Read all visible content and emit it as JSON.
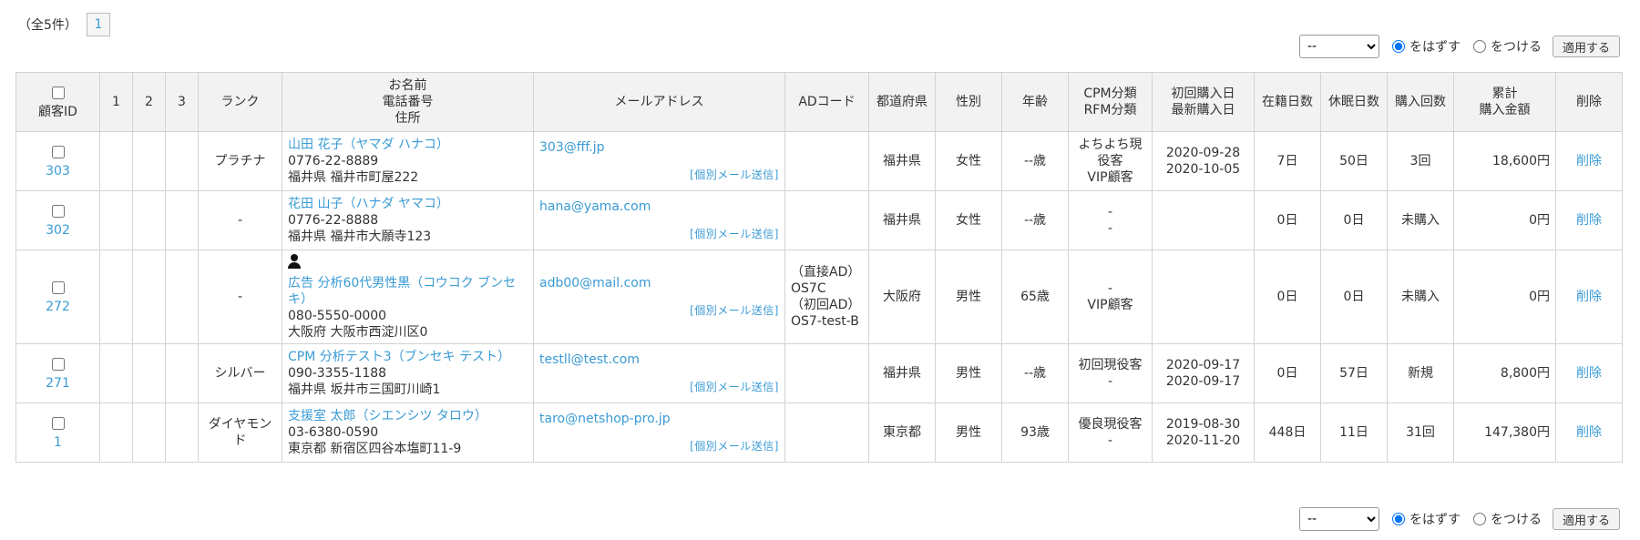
{
  "pager": {
    "total": "（全5件）",
    "page": "1"
  },
  "bulk": {
    "select_value": "--",
    "radio_remove": "をはずす",
    "radio_add": "をつける",
    "apply": "適用する"
  },
  "headers": {
    "id": "顧客ID",
    "c1": "1",
    "c2": "2",
    "c3": "3",
    "rank": "ランク",
    "name1": "お名前",
    "name2": "電話番号",
    "name3": "住所",
    "email": "メールアドレス",
    "ad": "ADコード",
    "pref": "都道府県",
    "gender": "性別",
    "age": "年齢",
    "cpm1": "CPM分類",
    "cpm2": "RFM分類",
    "buy1": "初回購入日",
    "buy2": "最新購入日",
    "days": "在籍日数",
    "dormant": "休眠日数",
    "count": "購入回数",
    "total1": "累計",
    "total2": "購入金額",
    "delete": "削除"
  },
  "mail_send_label": "[個別メール送信]",
  "delete_label": "削除",
  "rows": [
    {
      "id": "303",
      "rank": "プラチナ",
      "name": "山田 花子（ヤマダ ハナコ）",
      "phone": "0776-22-8889",
      "address": "福井県 福井市町屋222",
      "email": "303@fff.jp",
      "ad_line1": "",
      "ad_line2": "",
      "ad_line3": "",
      "ad_line4": "",
      "pref": "福井県",
      "gender": "女性",
      "age": "--歳",
      "cpm_line1": "よちよち現",
      "cpm_line2": "役客",
      "cpm_line3": "VIP顧客",
      "first_buy": "2020-09-28",
      "last_buy": "2020-10-05",
      "days": "7日",
      "dormant": "50日",
      "count": "3回",
      "total": "18,600円"
    },
    {
      "id": "302",
      "rank": "-",
      "name": "花田 山子（ハナダ ヤマコ）",
      "phone": "0776-22-8888",
      "address": "福井県 福井市大願寺123",
      "email": "hana@yama.com",
      "ad_line1": "",
      "ad_line2": "",
      "ad_line3": "",
      "ad_line4": "",
      "pref": "福井県",
      "gender": "女性",
      "age": "--歳",
      "cpm_line1": "-",
      "cpm_line2": "-",
      "cpm_line3": "",
      "first_buy": "",
      "last_buy": "",
      "days": "0日",
      "dormant": "0日",
      "count": "未購入",
      "total": "0円"
    },
    {
      "id": "272",
      "rank": "-",
      "name": "広告 分析60代男性黒（コウコク ブンセキ）",
      "phone": "080-5550-0000",
      "address": "大阪府 大阪市西淀川区0",
      "email": "adb00@mail.com",
      "ad_line1": "（直接AD）",
      "ad_line2": "OS7C",
      "ad_line3": "（初回AD）",
      "ad_line4": "OS7-test-B",
      "pref": "大阪府",
      "gender": "男性",
      "age": "65歳",
      "cpm_line1": "-",
      "cpm_line2": "VIP顧客",
      "cpm_line3": "",
      "first_buy": "",
      "last_buy": "",
      "days": "0日",
      "dormant": "0日",
      "count": "未購入",
      "total": "0円"
    },
    {
      "id": "271",
      "rank": "シルバー",
      "name": "CPM 分析テスト3（ブンセキ テスト）",
      "phone": "090-3355-1188",
      "address": "福井県 坂井市三国町川崎1",
      "email": "testll@test.com",
      "ad_line1": "",
      "ad_line2": "",
      "ad_line3": "",
      "ad_line4": "",
      "pref": "福井県",
      "gender": "男性",
      "age": "--歳",
      "cpm_line1": "初回現役客",
      "cpm_line2": "-",
      "cpm_line3": "",
      "first_buy": "2020-09-17",
      "last_buy": "2020-09-17",
      "days": "0日",
      "dormant": "57日",
      "count": "新規",
      "total": "8,800円"
    },
    {
      "id": "1",
      "rank": "ダイヤモンド",
      "name": "支援室 太郎（シエンシツ タロウ）",
      "phone": "03-6380-0590",
      "address": "東京都 新宿区四谷本塩町11-9",
      "email": "taro@netshop-pro.jp",
      "ad_line1": "",
      "ad_line2": "",
      "ad_line3": "",
      "ad_line4": "",
      "pref": "東京都",
      "gender": "男性",
      "age": "93歳",
      "cpm_line1": "優良現役客",
      "cpm_line2": "-",
      "cpm_line3": "",
      "first_buy": "2019-08-30",
      "last_buy": "2020-11-20",
      "days": "448日",
      "dormant": "11日",
      "count": "31回",
      "total": "147,380円"
    }
  ]
}
